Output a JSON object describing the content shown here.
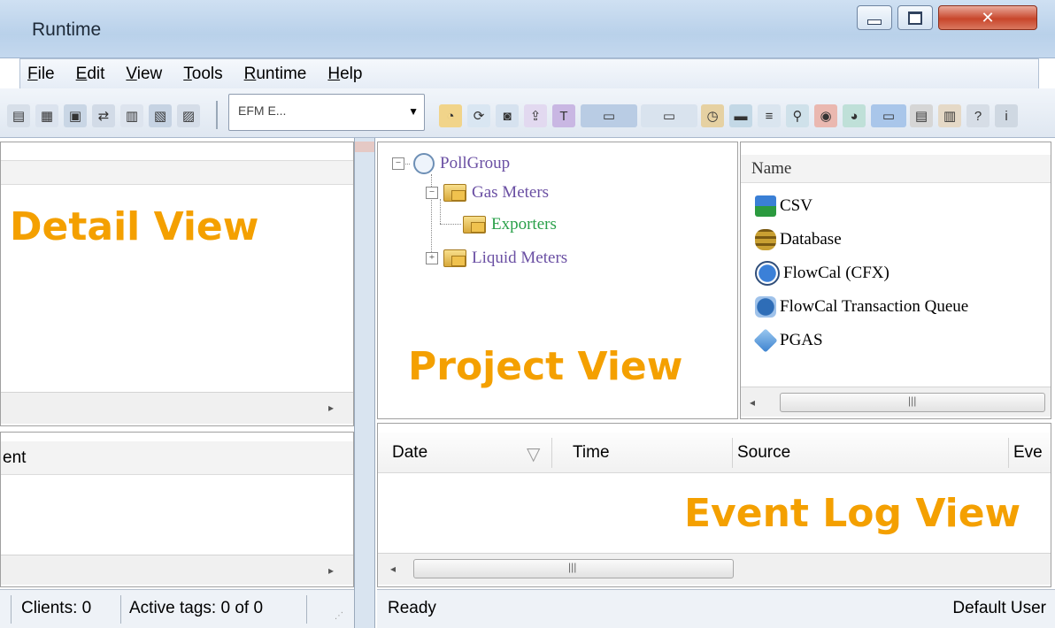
{
  "window": {
    "title": "Runtime"
  },
  "menu": [
    {
      "label": "File",
      "mnemonic": "F",
      "rest": "ile"
    },
    {
      "label": "Edit",
      "mnemonic": "E",
      "rest": "dit"
    },
    {
      "label": "View",
      "mnemonic": "V",
      "rest": "iew"
    },
    {
      "label": "Tools",
      "mnemonic": "T",
      "rest": "ools"
    },
    {
      "label": "Runtime",
      "mnemonic": "R",
      "rest": "untime"
    },
    {
      "label": "Help",
      "mnemonic": "H",
      "rest": "elp"
    }
  ],
  "toolbar": {
    "combo_value": "EFM E..."
  },
  "detail_view": {
    "overlay_label": "Detail View"
  },
  "left_event_pane": {
    "column_partial": "ent"
  },
  "project_view": {
    "overlay_label": "Project View",
    "tree": {
      "root": "PollGroup",
      "gas": "Gas Meters",
      "exporters": "Exporters",
      "liquid": "Liquid Meters"
    }
  },
  "exporters_list": {
    "header": "Name",
    "items": [
      "CSV",
      "Database",
      "FlowCal (CFX)",
      "FlowCal Transaction Queue",
      "PGAS"
    ],
    "scroll_grip": "|||"
  },
  "event_log": {
    "overlay_label": "Event Log View",
    "columns": {
      "date": "Date",
      "time": "Time",
      "source": "Source",
      "event_partial": "Eve"
    },
    "scroll_grip": "|||"
  },
  "status_left": {
    "clients": "Clients: 0",
    "active_tags": "Active tags: 0 of 0"
  },
  "status_right": {
    "state": "Ready",
    "user": "Default User"
  },
  "colors": {
    "overlay": "#f4a000",
    "title_bar": "#c4d8ee",
    "close_button": "#c8462b"
  }
}
